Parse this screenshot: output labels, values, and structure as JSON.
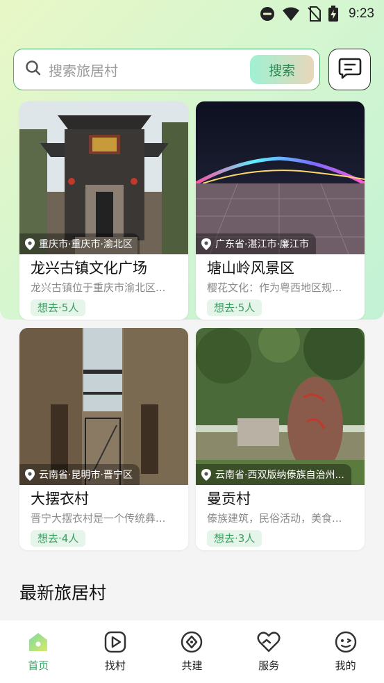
{
  "status_bar": {
    "time": "9:23"
  },
  "search": {
    "placeholder": "搜索旅居村",
    "button_label": "搜索"
  },
  "cards": [
    {
      "title": "龙兴古镇文化广场",
      "location": "重庆市·重庆市·渝北区",
      "description": "龙兴古镇位于重庆市渝北区...",
      "want_label": "想去·5人"
    },
    {
      "title": "塘山岭风景区",
      "location": "广东省·湛江市·廉江市",
      "description": "樱花文化：作为粤西地区规...",
      "want_label": "想去·5人"
    },
    {
      "title": "大摆衣村",
      "location": "云南省·昆明市·晋宁区",
      "description": "晋宁大摆衣村是一个传统彝...",
      "want_label": "想去·4人"
    },
    {
      "title": "曼贡村",
      "location": "云南省·西双版纳傣族自治州...",
      "description": "傣族建筑，民俗活动，美食...",
      "want_label": "想去·3人"
    }
  ],
  "section": {
    "latest_title": "最新旅居村"
  },
  "nav": {
    "items": [
      {
        "label": "首页",
        "icon": "home-icon",
        "active": true
      },
      {
        "label": "找村",
        "icon": "play-icon",
        "active": false
      },
      {
        "label": "共建",
        "icon": "compass-icon",
        "active": false
      },
      {
        "label": "服务",
        "icon": "heart-hands-icon",
        "active": false
      },
      {
        "label": "我的",
        "icon": "face-icon",
        "active": false
      }
    ]
  },
  "colors": {
    "accent": "#3aa564",
    "border": "#4fae6e",
    "badge_bg": "#e5f5ea"
  }
}
